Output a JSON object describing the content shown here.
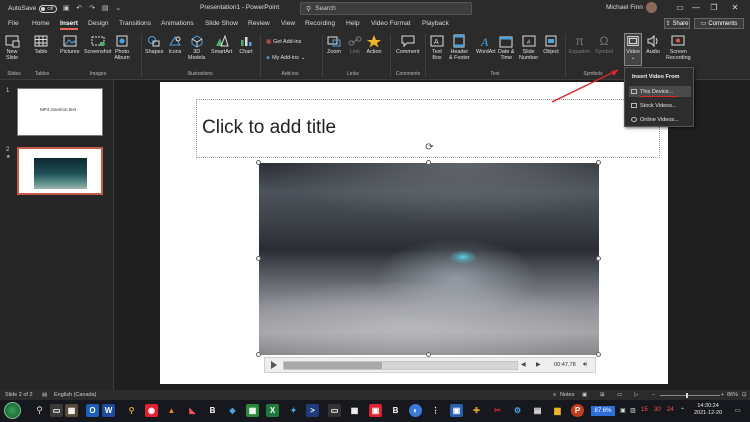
{
  "titlebar": {
    "autosave_label": "AutoSave",
    "autosave_state": "Off",
    "doc_title": "Presentation1 - PowerPoint",
    "search_placeholder": "Search",
    "user_name": "Michael Finn",
    "minimize": "—",
    "restore": "❐",
    "close": "✕"
  },
  "tabs": [
    "File",
    "Home",
    "Insert",
    "Design",
    "Transitions",
    "Animations",
    "Slide Show",
    "Review",
    "View",
    "Recording",
    "Help",
    "Video Format",
    "Playback"
  ],
  "active_tab": "Insert",
  "share_label": "Share",
  "comments_label": "Comments",
  "ribbon": {
    "new_slide": "New\nSlide",
    "table": "Table",
    "pictures": "Pictures",
    "screenshot": "Screenshot",
    "photo_album": "Photo\nAlbum",
    "shapes": "Shapes",
    "icons": "Icons",
    "models_3d": "3D\nModels",
    "smartart": "SmartArt",
    "chart": "Chart",
    "get_addins": "Get Add-ins",
    "my_addins": "My Add-ins",
    "zoom": "Zoom",
    "link": "Link",
    "action": "Action",
    "comment": "Comment",
    "text_box": "Text\nBox",
    "header_footer": "Header\n& Footer",
    "wordart": "WordArt",
    "date_time": "Date &\nTime",
    "slide_number": "Slide\nNumber",
    "object": "Object",
    "equation": "Equation",
    "symbol": "Symbol",
    "video": "Video",
    "audio": "Audio",
    "screen_recording": "Screen\nRecording",
    "groups": {
      "slides": "Slides",
      "tables": "Tables",
      "images": "Images",
      "illustrations": "Illustrations",
      "addins": "Add-ins",
      "links": "Links",
      "comments": "Comments",
      "text": "Text",
      "symbols": "Symbols"
    }
  },
  "video_menu": {
    "header": "Insert Video From",
    "items": [
      "This Device...",
      "Stock Videos...",
      "Online Videos..."
    ]
  },
  "slides": [
    {
      "number": "1",
      "text": "MP4 insertion test"
    },
    {
      "number": "2",
      "marker": "★"
    }
  ],
  "slide": {
    "title_placeholder": "Click to add title",
    "video_time": "00:47.78",
    "video_progress": 0.42
  },
  "status": {
    "slide_of": "Slide 2 of 2",
    "language": "English (Canada)",
    "notes": "Notes",
    "zoom": "86%"
  },
  "taskbar": {
    "battery_pct": "87.6%",
    "tray_15": "15",
    "tray_30": "30",
    "tray_24": "24",
    "time": "14:30:24",
    "date": "2021-12-20"
  },
  "colors": {
    "accent_red": "#d8282a",
    "active_tab_underline": "#e86a5c",
    "taskbar_highlight": "#2d6fd6"
  }
}
